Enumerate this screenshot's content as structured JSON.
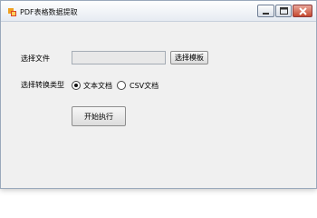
{
  "window": {
    "title": "PDF表格数据提取",
    "controls": [
      "minimize",
      "maximize",
      "close"
    ]
  },
  "form": {
    "file_label": "选择文件",
    "file_value": "",
    "choose_template_label": "选择模板",
    "convert_type_label": "选择转换类型",
    "options": [
      {
        "label": "文本文档",
        "selected": true
      },
      {
        "label": "CSV文档",
        "selected": false
      }
    ],
    "run_label": "开始执行"
  },
  "colors": {
    "form_bg": "#f0f0f0",
    "close_button": "#c5482f"
  }
}
